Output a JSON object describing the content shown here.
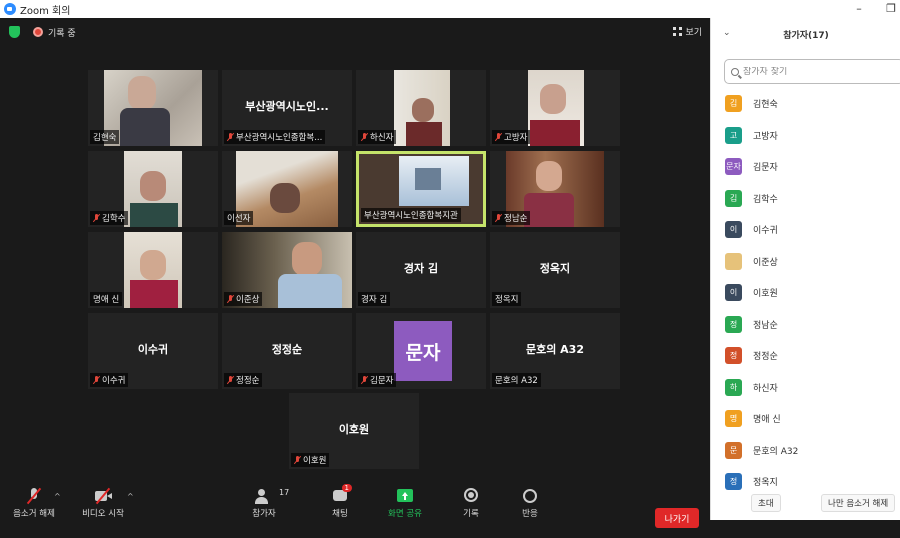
{
  "window": {
    "title": "Zoom 회의",
    "minimize": "–",
    "maximize": "❐"
  },
  "topbar": {
    "recording_label": "기록 중",
    "view_label": "보기"
  },
  "tiles": [
    {
      "name": "김현숙",
      "big": "",
      "muted": false,
      "video": true
    },
    {
      "name": "부산광역시노인종합복...",
      "big": "부산광역시노인...",
      "muted": true,
      "video": false
    },
    {
      "name": "하신자",
      "big": "",
      "muted": true,
      "video": true
    },
    {
      "name": "고방자",
      "big": "",
      "muted": true,
      "video": true
    },
    {
      "name": "김학수",
      "big": "",
      "muted": true,
      "video": true
    },
    {
      "name": "이선자",
      "big": "",
      "muted": false,
      "video": true
    },
    {
      "name": "부산광역시노인종합복지관",
      "big": "",
      "muted": false,
      "video": true,
      "active": true
    },
    {
      "name": "정남순",
      "big": "",
      "muted": true,
      "video": true
    },
    {
      "name": "명애 신",
      "big": "",
      "muted": false,
      "video": true
    },
    {
      "name": "이준상",
      "big": "",
      "muted": true,
      "video": true
    },
    {
      "name": "경자 김",
      "big": "경자 김",
      "muted": false,
      "video": false
    },
    {
      "name": "정옥지",
      "big": "정옥지",
      "muted": false,
      "video": false
    },
    {
      "name": "이수귀",
      "big": "이수귀",
      "muted": true,
      "video": false
    },
    {
      "name": "정정순",
      "big": "정정순",
      "muted": true,
      "video": false
    },
    {
      "name": "김문자",
      "big": "",
      "muted": true,
      "video": false,
      "avatar": "문자"
    },
    {
      "name": "문호의 A32",
      "big": "문호의 A32",
      "muted": false,
      "video": false
    },
    {
      "name": "이호원",
      "big": "이호원",
      "muted": true,
      "video": false
    }
  ],
  "toolbar": {
    "unmute": "음소거 해제",
    "start_video": "비디오 시작",
    "participants": "참가자",
    "participants_count": "17",
    "chat": "채팅",
    "chat_badge": "1",
    "share_screen": "화면 공유",
    "record": "기록",
    "reactions": "반응",
    "leave": "나가기"
  },
  "panel": {
    "title": "참가자(17)",
    "search_placeholder": "참가자 찾기",
    "participants": [
      {
        "initial": "김",
        "name": "김현숙",
        "color": "#f0a020"
      },
      {
        "initial": "고",
        "name": "고방자",
        "color": "#1a9e8a"
      },
      {
        "initial": "문자",
        "name": "김문자",
        "color": "#8d5bbf"
      },
      {
        "initial": "김",
        "name": "김학수",
        "color": "#2aa853"
      },
      {
        "initial": "이",
        "name": "이수귀",
        "color": "#3a4a5e"
      },
      {
        "initial": "",
        "name": "이준상",
        "color": "#e6c27a"
      },
      {
        "initial": "이",
        "name": "이호원",
        "color": "#3a4a5e"
      },
      {
        "initial": "정",
        "name": "정남순",
        "color": "#2aa853"
      },
      {
        "initial": "정",
        "name": "정정순",
        "color": "#d2502a"
      },
      {
        "initial": "하",
        "name": "하신자",
        "color": "#2aa853"
      },
      {
        "initial": "명",
        "name": "명애 신",
        "color": "#f0a020"
      },
      {
        "initial": "문",
        "name": "문호의 A32",
        "color": "#d2702a"
      },
      {
        "initial": "정",
        "name": "정옥지",
        "color": "#2a6fb8"
      }
    ],
    "invite": "초대",
    "unmute_me": "나만 음소거 해제"
  }
}
